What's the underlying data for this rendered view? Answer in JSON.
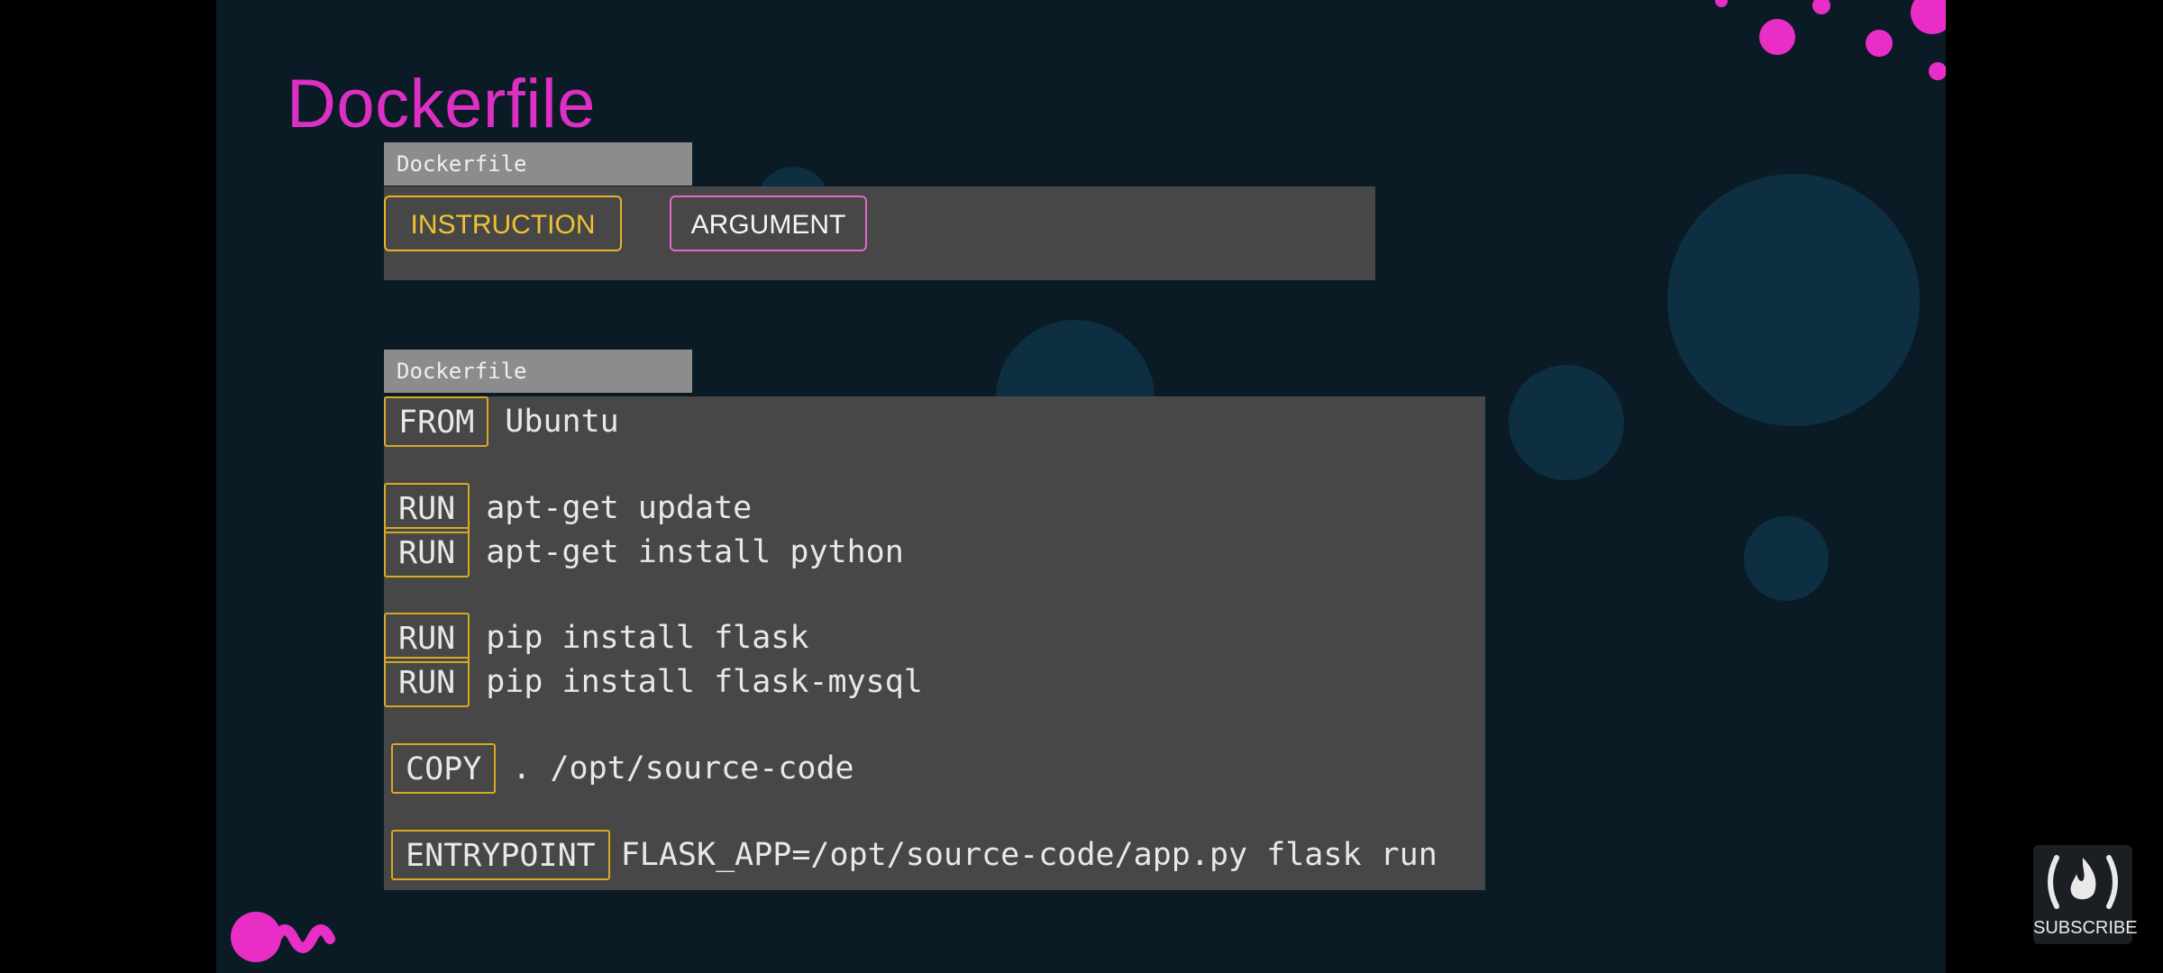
{
  "slide": {
    "title": "Dockerfile",
    "accent_color": "#de2fc4",
    "keyword_border_color": "#d7a925"
  },
  "syntax_box": {
    "tab_label": "Dockerfile",
    "instruction_label": "INSTRUCTION",
    "argument_label": "ARGUMENT"
  },
  "code_box": {
    "tab_label": "Dockerfile",
    "lines": [
      {
        "instruction": "FROM",
        "argument": "Ubuntu"
      },
      {
        "instruction": "RUN",
        "argument": "apt-get update"
      },
      {
        "instruction": "RUN",
        "argument": "apt-get install python"
      },
      {
        "instruction": "RUN",
        "argument": "pip install flask"
      },
      {
        "instruction": "RUN",
        "argument": "pip install flask-mysql"
      },
      {
        "instruction": "COPY",
        "argument": ". /opt/source-code"
      },
      {
        "instruction": "ENTRYPOINT",
        "argument": "FLASK_APP=/opt/source-code/app.py flask run"
      }
    ]
  },
  "subscribe": {
    "label": "SUBSCRIBE",
    "icon": "flame-in-parentheses-icon"
  }
}
